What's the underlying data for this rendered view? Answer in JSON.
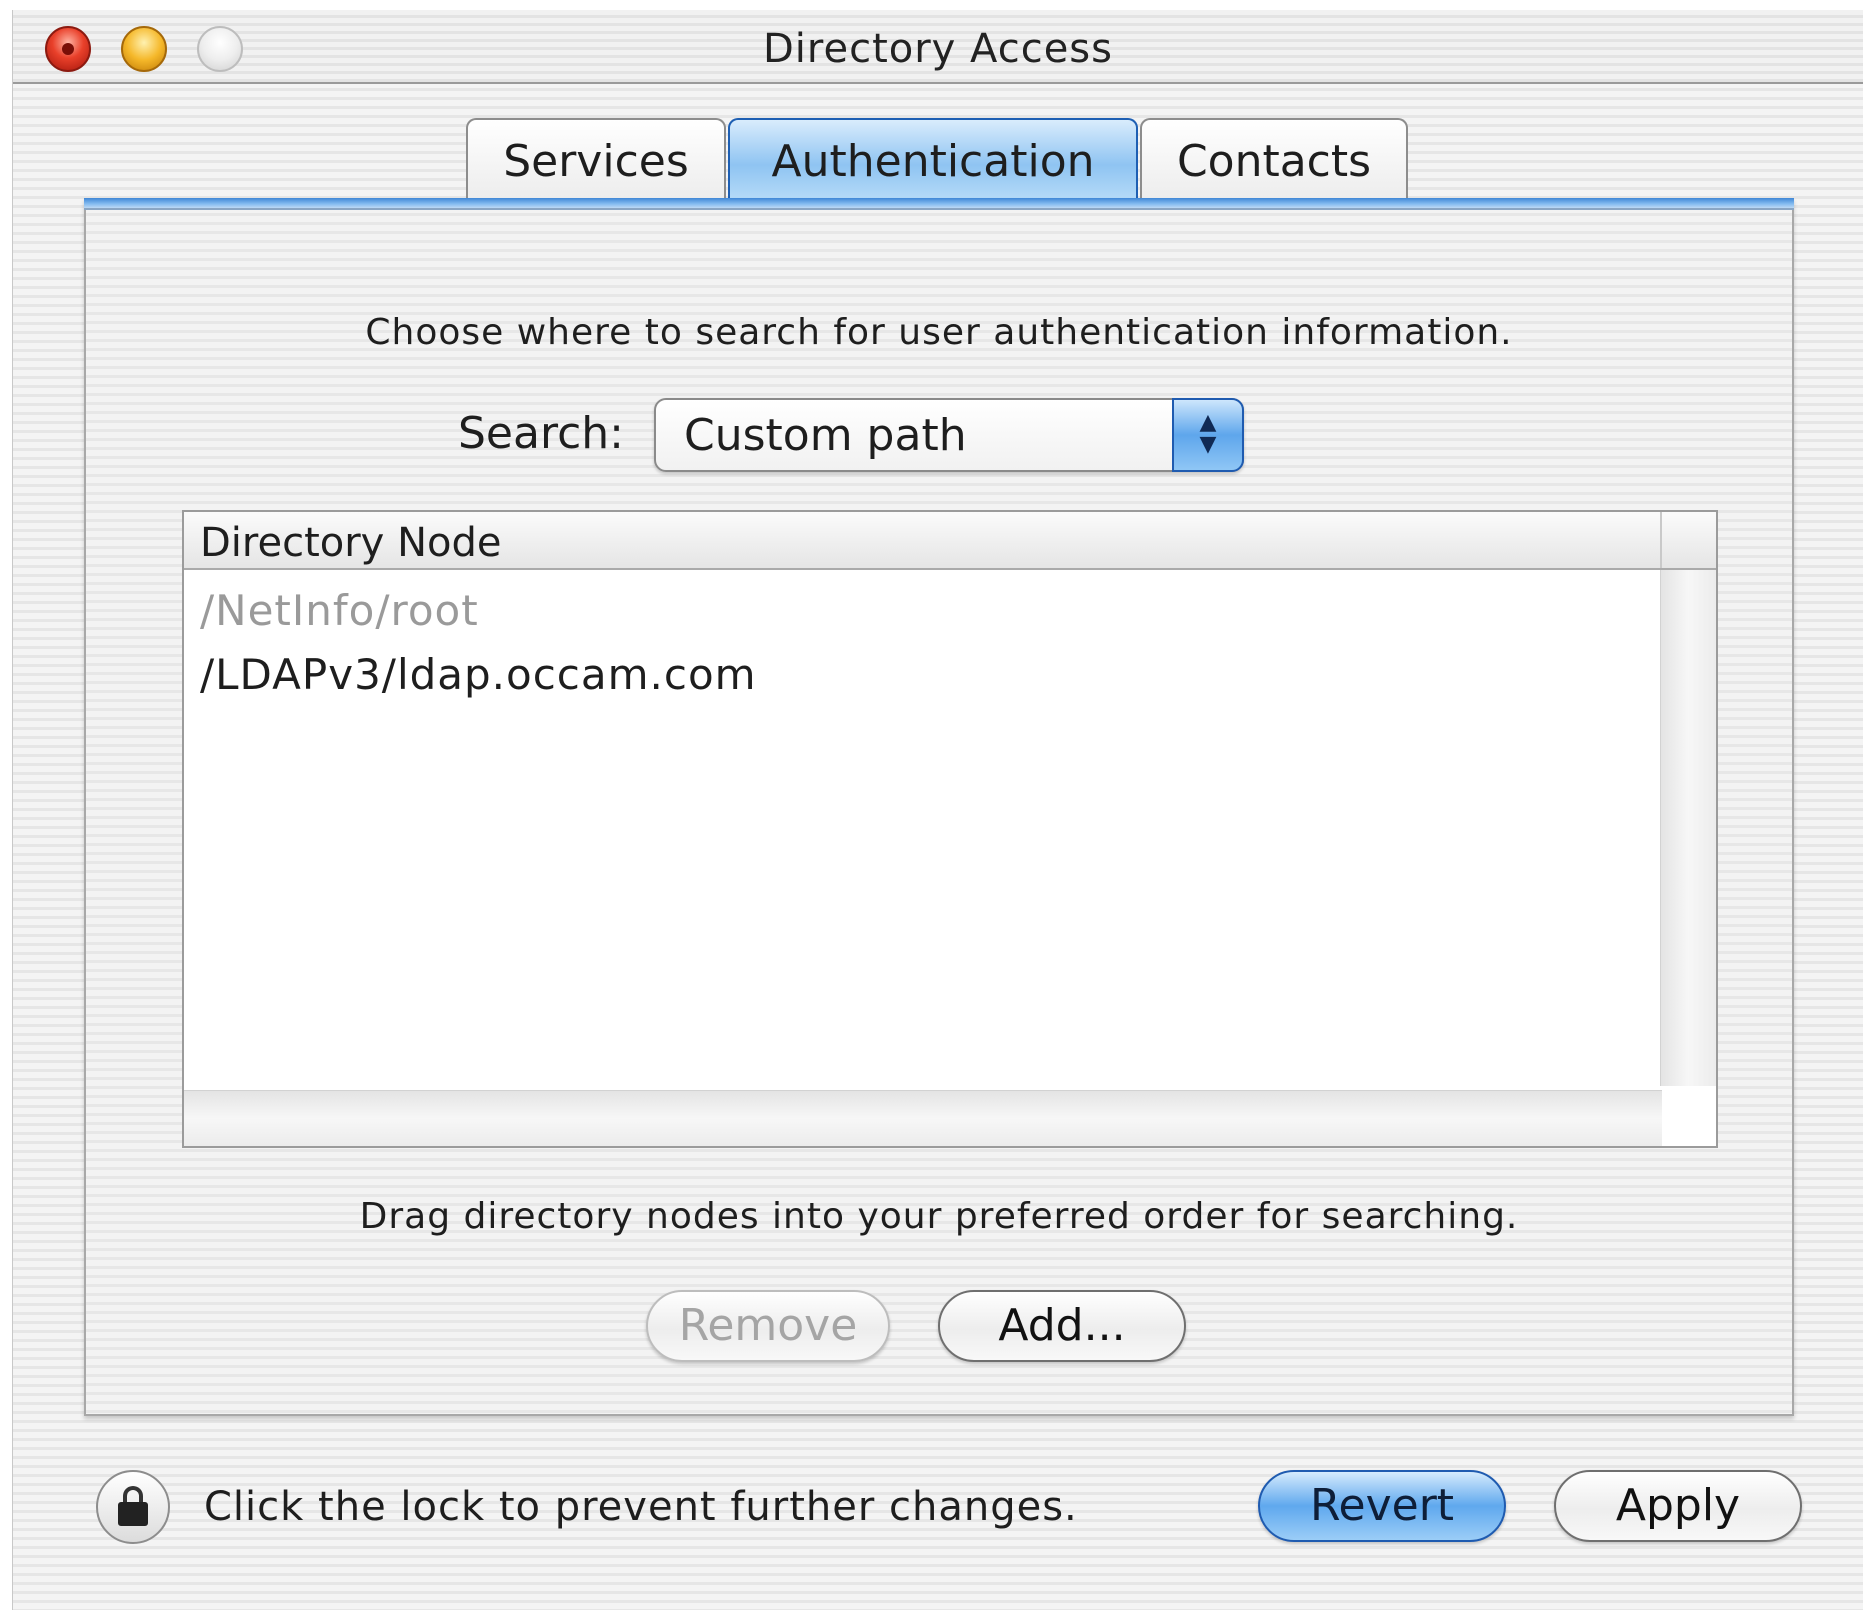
{
  "window": {
    "title": "Directory Access"
  },
  "tabs": [
    {
      "label": "Services"
    },
    {
      "label": "Authentication"
    },
    {
      "label": "Contacts"
    }
  ],
  "active_tab": "Authentication",
  "main": {
    "instruction_top": "Choose where to search for user authentication information.",
    "search_label": "Search:",
    "search_value": "Custom path",
    "table": {
      "column_header": "Directory Node",
      "rows": [
        {
          "value": "/NetInfo/root",
          "enabled": false
        },
        {
          "value": "/LDAPv3/ldap.occam.com",
          "enabled": true
        }
      ]
    },
    "instruction_bottom": "Drag directory nodes into your preferred order for searching.",
    "remove_label": "Remove",
    "add_label": "Add..."
  },
  "footer": {
    "lock_text": "Click the lock to prevent further changes.",
    "revert_label": "Revert",
    "apply_label": "Apply"
  },
  "colors": {
    "accent": "#5fa8ee",
    "disabled_text": "#9a9a9a"
  },
  "icons": {
    "lock": "lock-icon",
    "popup_arrows": "up-down-arrows-icon"
  }
}
